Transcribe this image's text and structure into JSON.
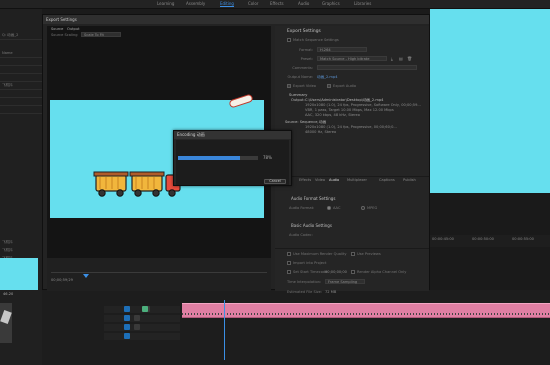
{
  "menubar": {
    "items": [
      "Learning",
      "Assembly",
      "Editing",
      "Color",
      "Effects",
      "Audio",
      "Graphics",
      "Libraries"
    ]
  },
  "export_dialog": {
    "title": "Export Settings",
    "source_tabs": [
      "Source",
      "Output"
    ],
    "source_scaling_label": "Source Scaling",
    "source_scaling_value": "Scale To Fit",
    "timecode_left": "00;00;59;29",
    "export_settings": {
      "heading": "Export Settings",
      "match_sequence_label": "Match Sequence Settings",
      "format_label": "Format:",
      "format_value": "H.264",
      "preset_label": "Preset:",
      "preset_value": "Match Source - High bitrate",
      "comments_label": "Comments:",
      "output_name_label": "Output Name:",
      "output_name_value": "动画_2.mp4",
      "export_video_label": "Export Video",
      "export_audio_label": "Export Audio"
    },
    "summary": {
      "heading": "Summary",
      "output_label": "Output:",
      "output_path": "C:\\Users\\Administrator\\Desktop\\动画_2.mp4",
      "output_lines": [
        "1920x1080 (1.0), 24 fps, Progressive, Software Only, 00;00;59...",
        "VBR, 1 pass, Target 10.00 Mbps, Max 12.00 Mbps",
        "AAC, 320 kbps, 48 kHz, Stereo"
      ],
      "source_label": "Source: Sequence,",
      "source_name": "动画",
      "source_lines": [
        "1920x1080 (1.0), 24 fps, Progressive, 00;00;60;0...",
        "48000 Hz, Stereo"
      ]
    },
    "settings_tabs": [
      "Effects",
      "Video",
      "Audio",
      "Multiplexer",
      "Captions",
      "Publish"
    ],
    "audio_format": {
      "heading": "Audio Format Settings",
      "label": "Audio Format:",
      "option_aac": "AAC",
      "option_mpeg": "MPEG"
    },
    "basic_audio": {
      "heading": "Basic Audio Settings",
      "codec_label": "Audio Codec:"
    },
    "lower_options": {
      "max_render_quality": "Use Maximum Render Quality",
      "use_previews": "Use Previews",
      "import_into_project": "Import into Project",
      "set_start_timecode": "Set Start Timecode",
      "start_timecode_value": "00;00;00;00",
      "render_alpha": "Render Alpha Channel Only",
      "time_interpolation_label": "Time Interpolation:",
      "time_interpolation_value": "Frame Sampling",
      "estimated_size_label": "Estimated File Size:",
      "estimated_size_value": "72 MB"
    }
  },
  "encoding_dialog": {
    "title": "Encoding 动画",
    "progress_percent": 78,
    "progress_label": "78%",
    "cancel_label": "Cancel"
  },
  "right_panel": {
    "ruler_ticks": [
      "00:00:45:00",
      "00:00:50:00",
      "00:00:55:00"
    ]
  },
  "left_panel": {
    "rows": [
      "Q: 动画_2",
      "",
      "",
      "Name",
      "",
      "",
      "",
      "",
      "飞机抖",
      "",
      "",
      "",
      "",
      ""
    ],
    "lower_rows": [
      "飞机抖",
      "飞机抖",
      "飞机抖"
    ],
    "value_label": "46.20"
  },
  "colors": {
    "preview_cyan": "#66dfee",
    "accent_blue": "#3a86da",
    "clip_pink": "#e07fa3",
    "track_toggle_blue": "#1d6fb8",
    "track_toggle_green": "#4caf7d"
  }
}
